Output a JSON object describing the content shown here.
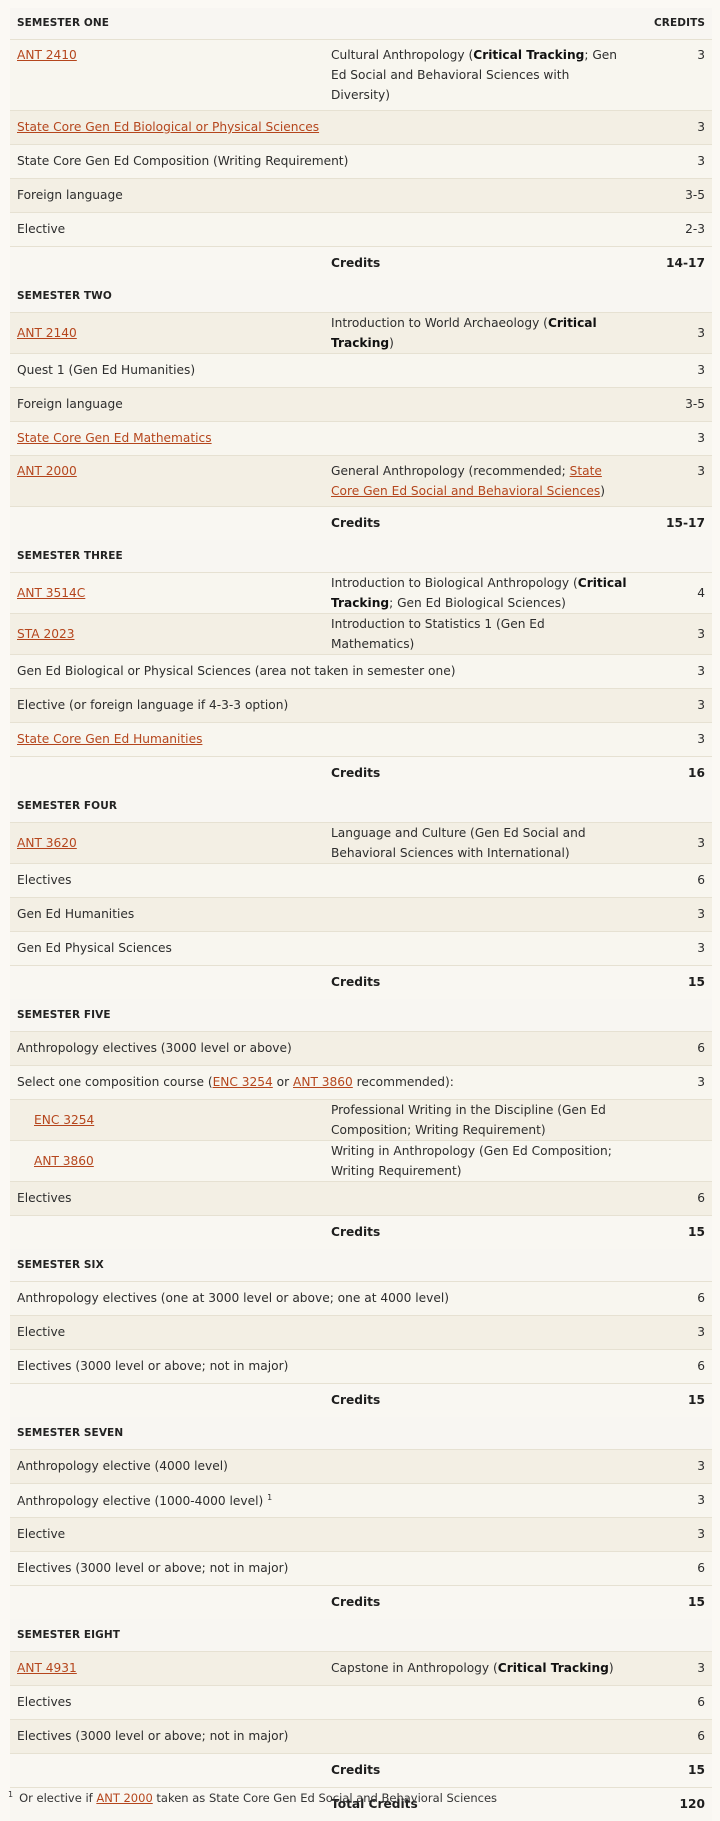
{
  "header": {
    "semester_label": "SEMESTER ONE",
    "credits_label": "CREDITS"
  },
  "s1": {
    "r1": {
      "code": "ANT 2410",
      "pre": "Cultural Anthropology (",
      "bold": "Critical Tracking",
      "post": "; Gen Ed Social and Behavioral Sciences with Diversity)",
      "credits": "3"
    },
    "r2": {
      "text": "State Core Gen Ed Biological or Physical Sciences",
      "credits": "3"
    },
    "r3": {
      "text": "State Core Gen Ed Composition (Writing Requirement)",
      "credits": "3"
    },
    "r4": {
      "text": "Foreign language",
      "credits": "3-5"
    },
    "r5": {
      "text": "Elective",
      "credits": "2-3"
    },
    "total": {
      "label": "Credits",
      "value": "14-17"
    }
  },
  "s2": {
    "title": "SEMESTER TWO",
    "r1": {
      "code": "ANT 2140",
      "pre": "Introduction to World Archaeology (",
      "bold": "Critical Tracking",
      "post": ")",
      "credits": "3"
    },
    "r2": {
      "text": "Quest 1 (Gen Ed Humanities)",
      "credits": "3"
    },
    "r3": {
      "text": "Foreign language",
      "credits": "3-5"
    },
    "r4": {
      "text": "State Core Gen Ed Mathematics",
      "credits": "3"
    },
    "r5": {
      "code": "ANT 2000",
      "pre": "General Anthropology (recommended; ",
      "link": "State Core Gen Ed Social and Behavioral Sciences",
      "post": ")",
      "credits": "3"
    },
    "total": {
      "label": "Credits",
      "value": "15-17"
    }
  },
  "s3": {
    "title": "SEMESTER THREE",
    "r1": {
      "code": "ANT 3514C",
      "pre": "Introduction to Biological Anthropology (",
      "bold": "Critical Tracking",
      "post": "; Gen Ed Biological Sciences)",
      "credits": "4"
    },
    "r2": {
      "code": "STA 2023",
      "desc": "Introduction to Statistics 1 (Gen Ed Mathematics)",
      "credits": "3"
    },
    "r3": {
      "text": "Gen Ed Biological or Physical Sciences (area not taken in semester one)",
      "credits": "3"
    },
    "r4": {
      "text": "Elective (or foreign language if 4-3-3 option)",
      "credits": "3"
    },
    "r5": {
      "text": "State Core Gen Ed Humanities",
      "credits": "3"
    },
    "total": {
      "label": "Credits",
      "value": "16"
    }
  },
  "s4": {
    "title": "SEMESTER FOUR",
    "r1": {
      "code": "ANT 3620",
      "desc": "Language and Culture (Gen Ed Social and Behavioral Sciences with International)",
      "credits": "3"
    },
    "r2": {
      "text": "Electives",
      "credits": "6"
    },
    "r3": {
      "text": "Gen Ed Humanities",
      "credits": "3"
    },
    "r4": {
      "text": "Gen Ed Physical Sciences",
      "credits": "3"
    },
    "total": {
      "label": "Credits",
      "value": "15"
    }
  },
  "s5": {
    "title": "SEMESTER FIVE",
    "r1": {
      "text": "Anthropology electives (3000 level or above)",
      "credits": "6"
    },
    "r2": {
      "pre": "Select one composition course (",
      "link1": "ENC 3254",
      "mid": " or ",
      "link2": "ANT 3860",
      "post": " recommended):",
      "credits": "3"
    },
    "r3": {
      "code": "ENC 3254",
      "desc": "Professional Writing in the Discipline (Gen Ed Composition; Writing Requirement)"
    },
    "r4": {
      "code": "ANT 3860",
      "desc": "Writing in Anthropology (Gen Ed Composition; Writing Requirement)"
    },
    "r5": {
      "text": "Electives",
      "credits": "6"
    },
    "total": {
      "label": "Credits",
      "value": "15"
    }
  },
  "s6": {
    "title": "SEMESTER SIX",
    "r1": {
      "text": "Anthropology electives (one at 3000 level or above; one at 4000 level)",
      "credits": "6"
    },
    "r2": {
      "text": "Elective",
      "credits": "3"
    },
    "r3": {
      "text": "Electives (3000 level or above; not in major)",
      "credits": "6"
    },
    "total": {
      "label": "Credits",
      "value": "15"
    }
  },
  "s7": {
    "title": "SEMESTER SEVEN",
    "r1": {
      "text": "Anthropology elective (4000 level)",
      "credits": "3"
    },
    "r2": {
      "text": "Anthropology elective (1000-4000 level) ",
      "sup": "1",
      "credits": "3"
    },
    "r3": {
      "text": "Elective",
      "credits": "3"
    },
    "r4": {
      "text": "Electives (3000 level or above; not in major)",
      "credits": "6"
    },
    "total": {
      "label": "Credits",
      "value": "15"
    }
  },
  "s8": {
    "title": "SEMESTER EIGHT",
    "r1": {
      "code": "ANT 4931",
      "pre": "Capstone in Anthropology (",
      "bold": "Critical Tracking",
      "post": ")",
      "credits": "3"
    },
    "r2": {
      "text": "Electives",
      "credits": "6"
    },
    "r3": {
      "text": "Electives (3000 level or above; not in major)",
      "credits": "6"
    },
    "total": {
      "label": "Credits",
      "value": "15"
    }
  },
  "grand_total": {
    "label": "Total Credits",
    "value": "120"
  },
  "footnote": {
    "num": "1",
    "pre": "Or elective if ",
    "link": "ANT 2000",
    "post": " taken as State Core Gen Ed Social and Behavioral Sciences"
  },
  "colors": {
    "link": "#b5461d",
    "row_alt": "#f3efe4",
    "background": "#fbf9f4"
  }
}
